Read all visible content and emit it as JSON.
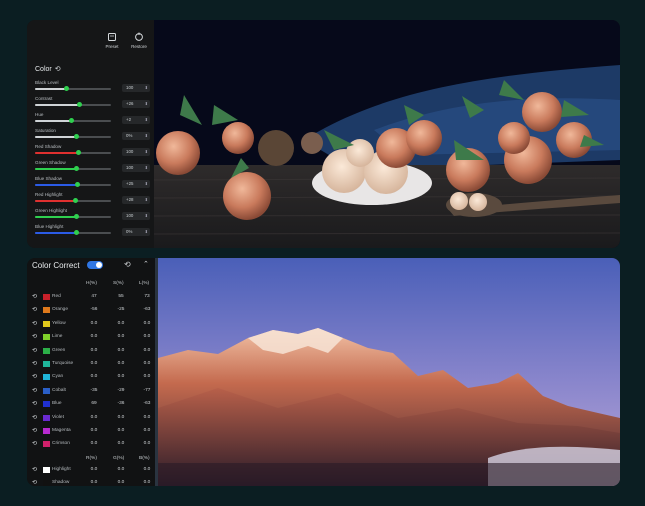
{
  "top_panel": {
    "toolbar": [
      {
        "label": "Preset",
        "icon": "preset-icon"
      },
      {
        "label": "Restore",
        "icon": "restore-icon"
      }
    ],
    "section_title": "Color",
    "reset_glyph": "⟲",
    "sliders": [
      {
        "label": "Black Level",
        "value": "100",
        "level": 0.42,
        "fill": "#cfd3d6"
      },
      {
        "label": "Contrast",
        "value": "+26",
        "level": 0.58,
        "fill": "#cfd3d6"
      },
      {
        "label": "Hue",
        "value": "+2",
        "level": 0.48,
        "fill": "#cfd3d6"
      },
      {
        "label": "Saturation",
        "value": "0%",
        "level": 0.55,
        "fill": "#cfd3d6"
      },
      {
        "label": "Red Shadow",
        "value": "100",
        "level": 0.57,
        "fill": "#e0302f"
      },
      {
        "label": "Green Shadow",
        "value": "100",
        "level": 0.55,
        "fill": "#2fd04f"
      },
      {
        "label": "Blue Shadow",
        "value": "+25",
        "level": 0.56,
        "fill": "#2b5be6"
      },
      {
        "label": "Red Highlight",
        "value": "+28",
        "level": 0.53,
        "fill": "#e0302f"
      },
      {
        "label": "Green Highlight",
        "value": "100",
        "level": 0.55,
        "fill": "#2fd04f"
      },
      {
        "label": "Blue Highlight",
        "value": "0%",
        "level": 0.55,
        "fill": "#2b5be6"
      }
    ]
  },
  "bottom_panel": {
    "title": "Color Correct",
    "reset_glyph": "⟲",
    "collapse_glyph": "⌃",
    "columns": [
      "H(%)",
      "S(%)",
      "L(%)"
    ],
    "rows": [
      {
        "name": "Red",
        "color": "#c8202a",
        "h": "47",
        "s": "55",
        "l": "73"
      },
      {
        "name": "Orange",
        "color": "#e07a1c",
        "h": "-56",
        "s": "-25",
        "l": "-63"
      },
      {
        "name": "Yellow",
        "color": "#e0c81c",
        "h": "0.0",
        "s": "0.0",
        "l": "0.0"
      },
      {
        "name": "Lime",
        "color": "#7fd02a",
        "h": "0.0",
        "s": "0.0",
        "l": "0.0"
      },
      {
        "name": "Green",
        "color": "#2cb048",
        "h": "0.0",
        "s": "0.0",
        "l": "0.0"
      },
      {
        "name": "Turquoise",
        "color": "#1fb59a",
        "h": "0.0",
        "s": "0.0",
        "l": "0.0"
      },
      {
        "name": "Cyan",
        "color": "#1fb4d8",
        "h": "0.0",
        "s": "0.0",
        "l": "0.0"
      },
      {
        "name": "Cobalt",
        "color": "#2a5fc8",
        "h": "-35",
        "s": "-29",
        "l": "-77"
      },
      {
        "name": "Blue",
        "color": "#2030d0",
        "h": "69",
        "s": "-36",
        "l": "-63"
      },
      {
        "name": "Violet",
        "color": "#6a2ad0",
        "h": "0.0",
        "s": "0.0",
        "l": "0.0"
      },
      {
        "name": "Magenta",
        "color": "#b82ad0",
        "h": "0.0",
        "s": "0.0",
        "l": "0.0"
      },
      {
        "name": "Crimson",
        "color": "#d0206a",
        "h": "0.0",
        "s": "0.0",
        "l": "0.0"
      }
    ],
    "columns2": [
      "R(%)",
      "G(%)",
      "B(%)"
    ],
    "rows2": [
      {
        "name": "Highlight",
        "color": "#ffffff",
        "r": "0.0",
        "g": "0.0",
        "b": "0.0"
      },
      {
        "name": "Shadow",
        "color": "#111111",
        "r": "0.0",
        "g": "0.0",
        "b": "0.0"
      }
    ]
  }
}
